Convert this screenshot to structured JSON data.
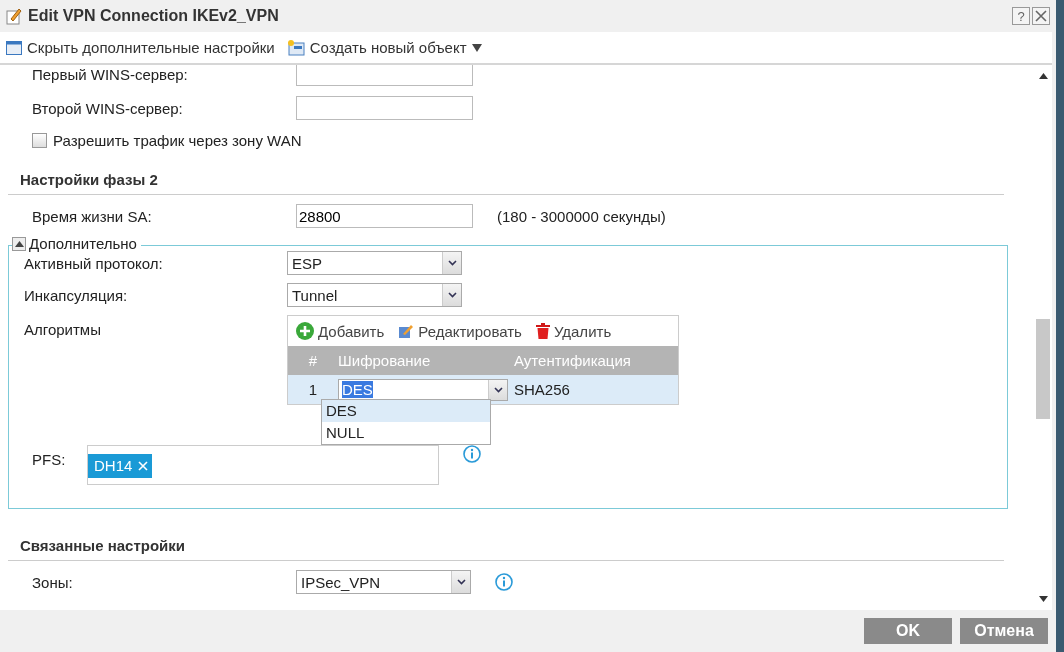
{
  "window": {
    "title": "Edit VPN Connection IKEv2_VPN",
    "help_button": "?"
  },
  "toolbar": [
    {
      "kind": "panel",
      "label": "Скрыть дополнительные настройки",
      "has_menu": false
    },
    {
      "kind": "create",
      "label": "Создать новый объект",
      "has_menu": true
    }
  ],
  "wins_fields": [
    {
      "label": "Первый WINS-сервер:"
    },
    {
      "label": "Второй WINS-сервер:"
    }
  ],
  "wan_checkbox": {
    "label": "Разрешить трафик через зону WAN",
    "checked": false
  },
  "phase2": {
    "title": "Настройки фазы 2",
    "sa_label": "Время жизни SA:",
    "sa_value": "28800",
    "sa_hint": "(180 - 3000000 секунды)"
  },
  "advanced": {
    "legend": "Дополнительно",
    "expanded": true,
    "selects": [
      {
        "label": "Активный протокол:",
        "value": "ESP"
      },
      {
        "label": "Инкапсуляция:",
        "value": "Tunnel"
      }
    ],
    "algorithms": {
      "label": "Алгоритмы",
      "actions": [
        {
          "kind": "add",
          "label": "Добавить"
        },
        {
          "kind": "edit",
          "label": "Редактировать"
        },
        {
          "kind": "delete",
          "label": "Удалить"
        }
      ],
      "columns": [
        "#",
        "Шифрование",
        "Аутентификация"
      ],
      "rows": [
        {
          "index": "1",
          "encryption": "DES",
          "authentication": "SHA256",
          "selected": true
        }
      ],
      "dropdown_options": [
        {
          "label": "DES",
          "selected": true
        },
        {
          "label": "NULL",
          "selected": false
        }
      ]
    },
    "pfs": {
      "label": "PFS:",
      "tags": [
        "DH14"
      ]
    }
  },
  "related": {
    "title": "Связанные настройки",
    "zones_label": "Зоны:",
    "zones_value": "IPSec_VPN"
  },
  "buttons": [
    "OK",
    "Отмена"
  ]
}
